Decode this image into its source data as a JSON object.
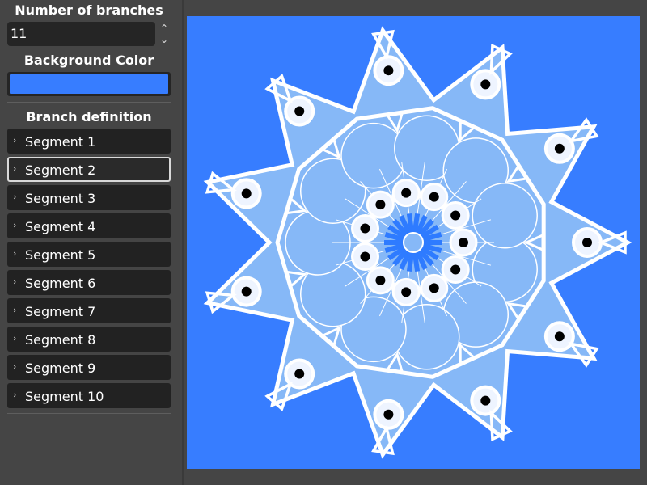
{
  "sidebar": {
    "branches_title": "Number of branches",
    "branches_value": "11",
    "up_arrow": "⌃",
    "down_arrow": "⌄",
    "bg_title": "Background Color",
    "branch_def_title": "Branch definition",
    "segments": [
      "Segment 1",
      "Segment 2",
      "Segment 3",
      "Segment 4",
      "Segment 5",
      "Segment 6",
      "Segment 7",
      "Segment 8",
      "Segment 9",
      "Segment 10"
    ],
    "focused_segment": 1
  },
  "colors": {
    "background": "#377dff",
    "light_fill": "#86b8f7",
    "white": "#ffffff",
    "dot": "#000000",
    "ring_fill": "#eef4ff",
    "center_spokes": "#2e7bff"
  },
  "design": {
    "branches": 11
  }
}
